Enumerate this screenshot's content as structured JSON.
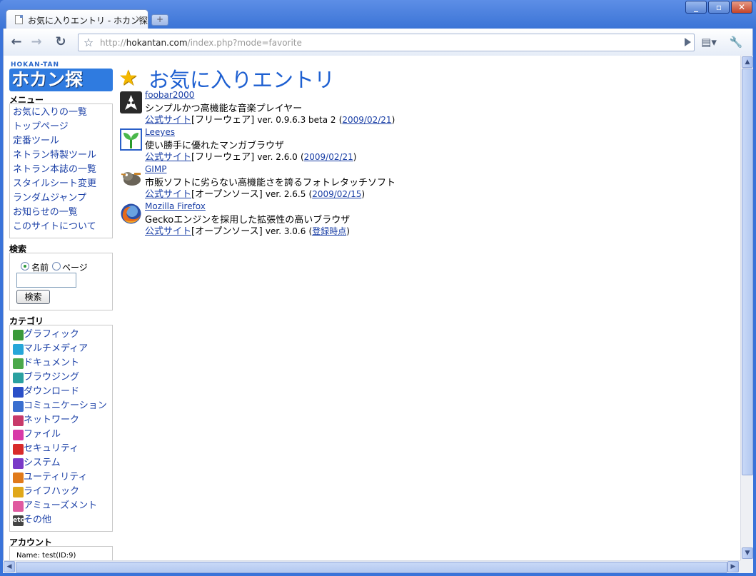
{
  "browser": {
    "tab_title": "お気に入りエントリ - ホカン探",
    "tab_close": "×",
    "new_tab": "+",
    "url_scheme": "http://",
    "url_host": "hokantan.com",
    "url_path": "/index.php?mode=favorite"
  },
  "logo": {
    "top_text": "HOKAN-TAN",
    "main_text": "ホカン探"
  },
  "sidebar": {
    "menu_heading": "メニュー",
    "menu_items": [
      "お気に入りの一覧",
      "トップページ",
      "定番ツール",
      "ネトラン特製ツール",
      "ネトラン本誌の一覧",
      "スタイルシート変更",
      "ランダムジャンプ",
      "お知らせの一覧",
      "このサイトについて"
    ],
    "search_heading": "検索",
    "search_option_name": "名前",
    "search_option_page": "ページ",
    "search_button": "検索",
    "category_heading": "カテゴリ",
    "categories": [
      {
        "label": "グラフィック",
        "icon": "graphic-icon",
        "color": "#3a9a3a"
      },
      {
        "label": "マルチメディア",
        "icon": "multimedia-icon",
        "color": "#27a6d8"
      },
      {
        "label": "ドキュメント",
        "icon": "document-icon",
        "color": "#4aa84a"
      },
      {
        "label": "ブラウジング",
        "icon": "browsing-icon",
        "color": "#2aa0a0"
      },
      {
        "label": "ダウンロード",
        "icon": "download-icon",
        "color": "#2a4fc8"
      },
      {
        "label": "コミュニケーション",
        "icon": "communication-icon",
        "color": "#3a6fd0"
      },
      {
        "label": "ネットワーク",
        "icon": "network-icon",
        "color": "#c83a6a"
      },
      {
        "label": "ファイル",
        "icon": "file-icon",
        "color": "#d83aa8"
      },
      {
        "label": "セキュリティ",
        "icon": "security-icon",
        "color": "#d82a2a"
      },
      {
        "label": "システム",
        "icon": "system-icon",
        "color": "#7a3ac8"
      },
      {
        "label": "ユーティリティ",
        "icon": "utility-icon",
        "color": "#e07a1a"
      },
      {
        "label": "ライフハック",
        "icon": "lifehack-icon",
        "color": "#e0a81a"
      },
      {
        "label": "アミューズメント",
        "icon": "amusement-icon",
        "color": "#e05aa0"
      },
      {
        "label": "その他",
        "icon": "etc-icon",
        "color": "#444444",
        "icon_text": "etc"
      }
    ],
    "account_heading": "アカウント",
    "account_name": "Name: test(ID:9)"
  },
  "main": {
    "title": "お気に入りエントリ",
    "entries": [
      {
        "name": "foobar2000",
        "desc": "シンプルかつ高機能な音楽プレイヤー",
        "site": "公式サイト",
        "license": "[フリーウェア]",
        "version": "ver. 0.9.6.3 beta 2",
        "date": "2009/02/21",
        "icon": "foobar2000-icon"
      },
      {
        "name": "Leeyes",
        "desc": "使い勝手に優れたマンガブラウザ",
        "site": "公式サイト",
        "license": "[フリーウェア]",
        "version": "ver. 2.6.0",
        "date": "2009/02/21",
        "icon": "leeyes-icon"
      },
      {
        "name": "GIMP",
        "desc": "市販ソフトに劣らない高機能さを誇るフォトレタッチソフト",
        "site": "公式サイト",
        "license": "[オープンソース]",
        "version": "ver. 2.6.5",
        "date": "2009/02/15",
        "icon": "gimp-icon"
      },
      {
        "name": "Mozilla Firefox",
        "desc": "Geckoエンジンを採用した拡張性の高いブラウザ",
        "site": "公式サイト",
        "license": "[オープンソース]",
        "version": "ver. 3.0.6",
        "date": "登録時点",
        "icon": "firefox-icon"
      }
    ]
  }
}
